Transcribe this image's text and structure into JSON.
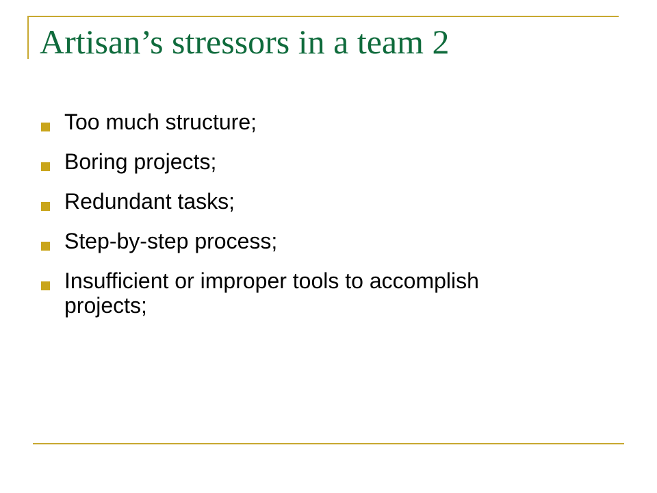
{
  "slide": {
    "title": "Artisan’s stressors in a team 2",
    "bullets": [
      {
        "text": "Too much structure;"
      },
      {
        "text": "Boring projects;"
      },
      {
        "text": "Redundant tasks;"
      },
      {
        "text": "Step-by-step process;"
      },
      {
        "text": "Insufficient or improper tools to accomplish projects;"
      }
    ]
  },
  "colors": {
    "title": "#0f6b3c",
    "accent": "#c8a830",
    "bullet_marker": "#c9a51b",
    "text": "#000000",
    "background": "#ffffff"
  }
}
